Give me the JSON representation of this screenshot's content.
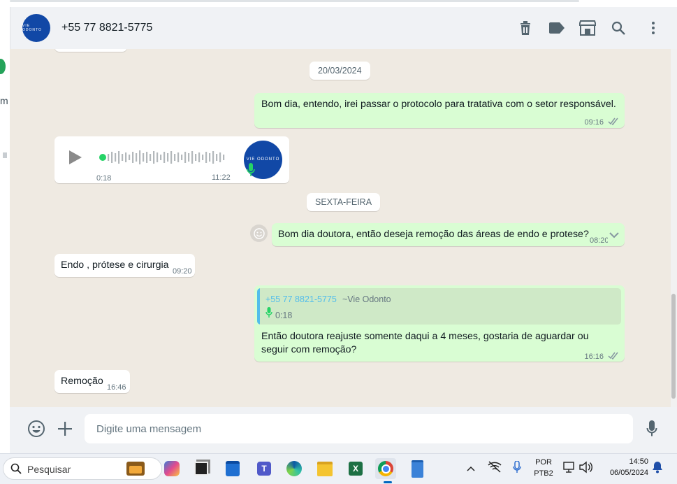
{
  "header": {
    "avatar_text": "VIE ODONTO",
    "contact_name": "+55 77 8821-5775",
    "icons": [
      "trash-icon",
      "label-icon",
      "shop-icon",
      "search-icon",
      "menu-icon"
    ]
  },
  "chat": {
    "messages": [
      {
        "kind": "date",
        "text": "20/03/2024"
      },
      {
        "kind": "out",
        "text": "Bom dia, entendo, irei passar o protocolo para tratativa com o setor responsável.",
        "time": "09:16"
      },
      {
        "kind": "voice-in",
        "position": "0:18",
        "time": "11:22",
        "avatar_text": "VIE ODONTO"
      },
      {
        "kind": "date",
        "text": "SEXTA-FEIRA"
      },
      {
        "kind": "out",
        "text": "Bom dia doutora, então deseja remoção das áreas de endo e protese?",
        "time": "08:20"
      },
      {
        "kind": "in",
        "text": "Endo , prótese e cirurgia",
        "time": "09:20"
      },
      {
        "kind": "out-reply",
        "quote_author": "+55 77 8821-5775",
        "quote_name": "~Vie Odonto",
        "quote_voice": "0:18",
        "text": "Então doutora reajuste somente daqui a 4 meses, gostaria de aguardar ou seguir com remoção?",
        "time": "16:16"
      },
      {
        "kind": "in",
        "text": "Remoção",
        "time": "16:46"
      }
    ]
  },
  "footer": {
    "placeholder": "Digite uma mensagem"
  },
  "taskbar": {
    "search_label": "Pesquisar",
    "lang_top": "POR",
    "lang_bottom": "PTB2",
    "time": "14:50",
    "date": "06/05/2024",
    "apps": [
      "widgets",
      "copilot",
      "task-view",
      "store",
      "teams",
      "edge",
      "file-explorer",
      "excel",
      "chrome",
      "notepad"
    ]
  },
  "colors": {
    "outgoing": "#d9fdd3",
    "incoming": "#ffffff",
    "chat_bg": "#efeae2",
    "accent": "#25d366",
    "link": "#53bdeb"
  }
}
